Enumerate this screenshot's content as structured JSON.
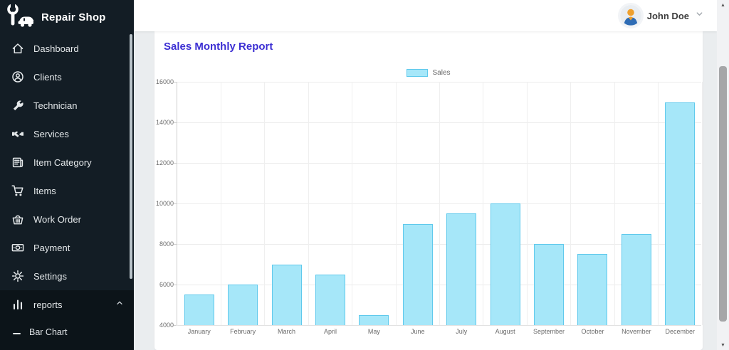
{
  "sidebar": {
    "brand": "Repair Shop",
    "items": [
      {
        "icon": "home-icon",
        "label": "Dashboard"
      },
      {
        "icon": "clients-icon",
        "label": "Clients"
      },
      {
        "icon": "wrench-icon",
        "label": "Technician"
      },
      {
        "icon": "handshake-icon",
        "label": "Services"
      },
      {
        "icon": "newspaper-icon",
        "label": "Item Category"
      },
      {
        "icon": "cart-icon",
        "label": "Items"
      },
      {
        "icon": "basket-icon",
        "label": "Work Order"
      },
      {
        "icon": "banknote-icon",
        "label": "Payment"
      },
      {
        "icon": "gear-icon",
        "label": "Settings"
      }
    ],
    "reports": {
      "icon": "bar-chart-icon",
      "label": "reports",
      "chevron": "chevron-up-icon",
      "expanded": true
    },
    "submenu": [
      {
        "icon": "dash-icon",
        "label": "Bar Chart"
      }
    ]
  },
  "header": {
    "user_name": "John Doe",
    "chevron": "chevron-down-icon",
    "avatar": "user-avatar-icon"
  },
  "main": {
    "title": "Sales Monthly Report"
  },
  "chart_data": {
    "type": "bar",
    "title": "Sales Monthly Report",
    "legend_label": "Sales",
    "legend_position": "top-center",
    "grid": true,
    "categories": [
      "January",
      "February",
      "March",
      "April",
      "May",
      "June",
      "July",
      "August",
      "September",
      "October",
      "November",
      "December"
    ],
    "series": [
      {
        "name": "Sales",
        "values": [
          5500,
          6000,
          7000,
          6500,
          4500,
          9000,
          9500,
          10000,
          8000,
          7500,
          8500,
          15000
        ]
      }
    ],
    "ylim": [
      4000,
      16000
    ],
    "ytick_step": 2000,
    "bar_fill": "#a6e7f9",
    "bar_border": "#5fc9ec"
  },
  "colors": {
    "sidebar_bg": "#131d25",
    "reports_section_bg": "#0c1419",
    "title": "#3c2fd3",
    "bar_fill": "#a6e7f9",
    "bar_border": "#5fc9ec"
  },
  "scrollbar": {
    "up_glyph": "▲",
    "down_glyph": "▼"
  }
}
